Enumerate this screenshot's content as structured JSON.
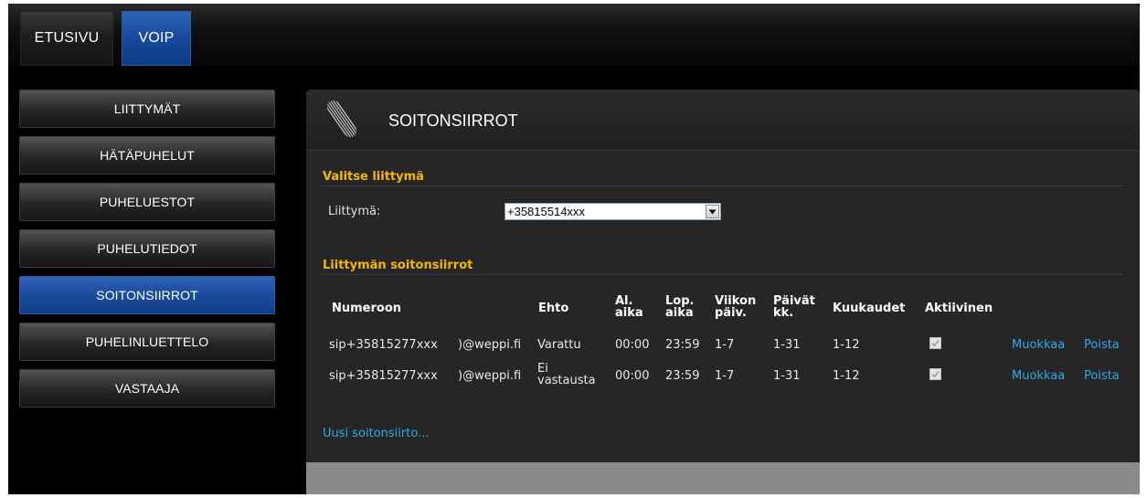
{
  "top_nav": [
    {
      "label": "ETUSIVU",
      "active": false
    },
    {
      "label": "VOIP",
      "active": true
    }
  ],
  "sidebar": {
    "items": [
      {
        "label": "LIITTYMÄT"
      },
      {
        "label": "HÄTÄPUHELUT"
      },
      {
        "label": "PUHELUESTOT"
      },
      {
        "label": "PUHELUTIEDOT"
      },
      {
        "label": "SOITONSIIRROT",
        "active": true
      },
      {
        "label": "PUHELINLUETTELO"
      },
      {
        "label": "VASTAAJA"
      }
    ]
  },
  "panel": {
    "title": "SOITONSIIRROT",
    "select_section": {
      "title": "Valitse liittymä",
      "field_label": "Liittymä:",
      "selected_value": "+35815514xxx"
    },
    "forwards_section": {
      "title": "Liittymän soitonsiirrot",
      "columns": [
        {
          "lines": [
            "Numeroon"
          ]
        },
        {
          "lines": [
            "Ehto"
          ]
        },
        {
          "lines": [
            "Al.",
            "aika"
          ]
        },
        {
          "lines": [
            "Lop.",
            "aika"
          ]
        },
        {
          "lines": [
            "Viikon",
            "päiv."
          ]
        },
        {
          "lines": [
            "Päivät",
            "kk."
          ]
        },
        {
          "lines": [
            "Kuukaudet"
          ]
        },
        {
          "lines": [
            "Aktiivinen"
          ]
        }
      ],
      "rows": [
        {
          "number": "sip+35815277xxx",
          "number_domain": ")@weppi.fi",
          "condition": [
            "Varattu"
          ],
          "start": "00:00",
          "end": "23:59",
          "weekdays": "1-7",
          "days": "1-31",
          "months": "1-12",
          "active": true,
          "edit": "Muokkaa",
          "delete": "Poista"
        },
        {
          "number": "sip+35815277xxx",
          "number_domain": ")@weppi.fi",
          "condition": [
            "Ei",
            "vastausta"
          ],
          "start": "00:00",
          "end": "23:59",
          "weekdays": "1-7",
          "days": "1-31",
          "months": "1-12",
          "active": true,
          "edit": "Muokkaa",
          "delete": "Poista"
        }
      ],
      "new_link": "Uusi soitonsiirto..."
    }
  },
  "colors": {
    "accent_blue": "#164a9c",
    "section_title": "#f5b800",
    "link": "#2fa8e6"
  }
}
